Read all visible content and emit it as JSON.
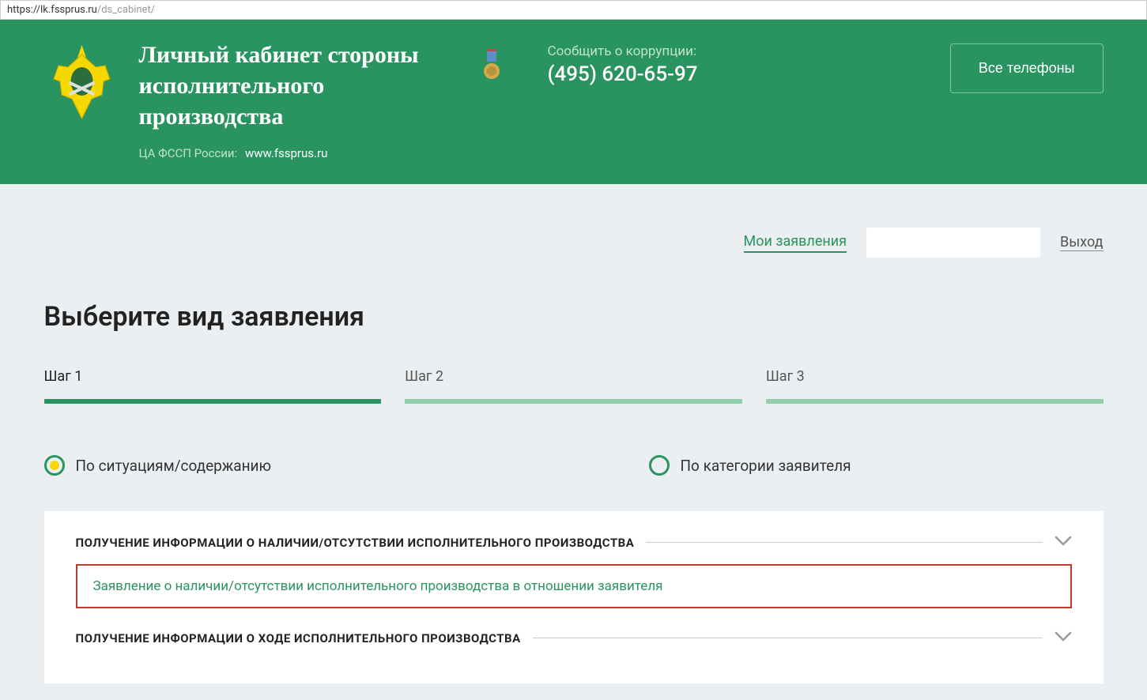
{
  "url": {
    "base": "https://lk.fssprus.ru",
    "path": "/ds_cabinet/"
  },
  "header": {
    "title": "Личный кабинет стороны исполнительного производства",
    "subtitle_prefix": "ЦА ФССП России:",
    "subtitle_link": "www.fssprus.ru",
    "corruption_label": "Сообщить о коррупции:",
    "corruption_phone": "(495) 620-65-97",
    "all_phones": "Все телефоны"
  },
  "top_nav": {
    "my_applications": "Мои заявления",
    "logout": "Выход"
  },
  "page": {
    "heading": "Выберите вид заявления",
    "steps": [
      "Шаг 1",
      "Шаг 2",
      "Шаг 3"
    ],
    "active_step": 0,
    "radios": {
      "by_situation": "По ситуациям/содержанию",
      "by_category": "По категории заявителя",
      "selected": "by_situation"
    },
    "accordion": {
      "section1_title": "ПОЛУЧЕНИЕ ИНФОРМАЦИИ О НАЛИЧИИ/ОТСУТСТВИИ ИСПОЛНИТЕЛЬНОГО ПРОИЗВОДСТВА",
      "section1_item": "Заявление о наличии/отсутствии исполнительного производства в отношении заявителя",
      "section2_title": "ПОЛУЧЕНИЕ ИНФОРМАЦИИ О ХОДЕ ИСПОЛНИТЕЛЬНОГО ПРОИЗВОДСТВА"
    }
  }
}
